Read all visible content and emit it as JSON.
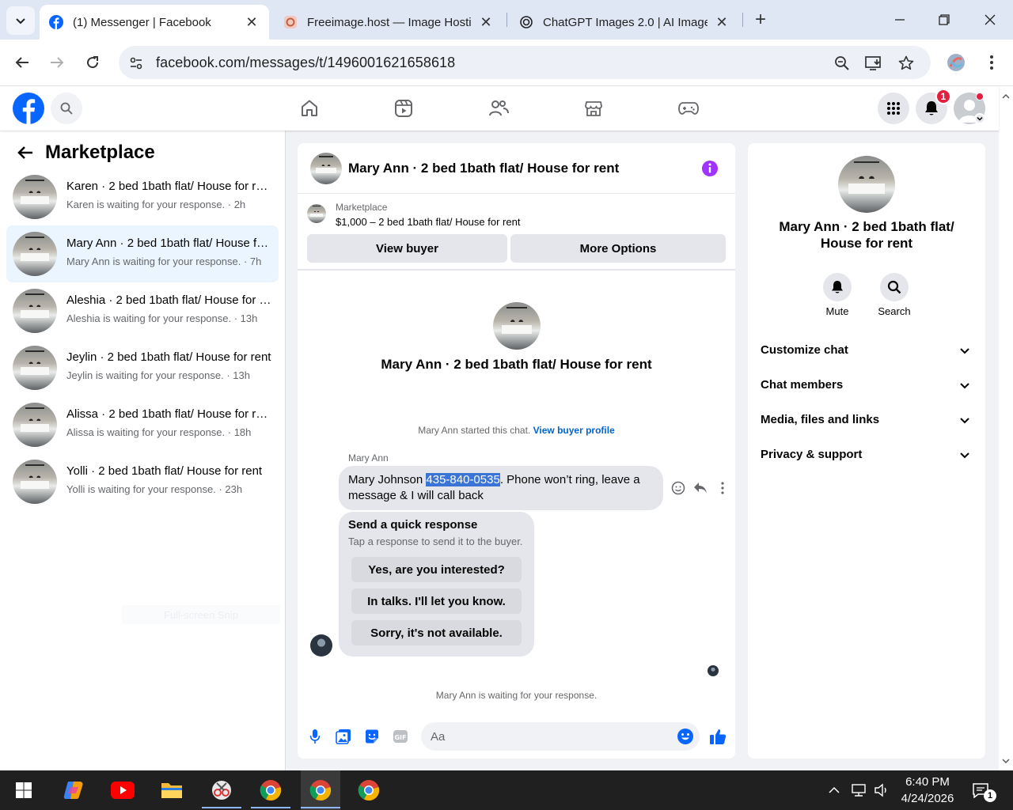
{
  "browser": {
    "tabs": [
      {
        "title": "(1) Messenger | Facebook",
        "active": true,
        "icon": "facebook-icon"
      },
      {
        "title": "Freeimage.host — Image Hosting",
        "active": false,
        "icon": "freeimage-icon"
      },
      {
        "title": "ChatGPT Images 2.0 | AI Image",
        "active": false,
        "icon": "openai-icon"
      }
    ],
    "url": "facebook.com/messages/t/1496001621658618"
  },
  "fb_header": {
    "notification_count": "1",
    "nav_icons": [
      "home-icon",
      "video-icon",
      "friends-icon",
      "marketplace-icon",
      "gaming-icon"
    ]
  },
  "sidebar": {
    "title": "Marketplace",
    "conversations": [
      {
        "name": "Karen · 2 bed 1bath flat/ House for rent",
        "status": "Karen is waiting for your response. · 2h",
        "selected": false
      },
      {
        "name": "Mary Ann · 2 bed 1bath flat/ House for rent",
        "status": "Mary Ann is waiting for your response. · 7h",
        "selected": true
      },
      {
        "name": "Aleshia · 2 bed 1bath flat/ House for rent",
        "status": "Aleshia is waiting for your response. · 13h",
        "selected": false
      },
      {
        "name": "Jeylin · 2 bed 1bath flat/ House for rent",
        "status": "Jeylin is waiting for your response. · 13h",
        "selected": false
      },
      {
        "name": "Alissa · 2 bed 1bath flat/ House for rent",
        "status": "Alissa is waiting for your response. · 18h",
        "selected": false
      },
      {
        "name": "Yolli · 2 bed 1bath flat/ House for rent",
        "status": "Yolli is waiting for your response. · 23h",
        "selected": false
      }
    ],
    "ghost_text": "Full-screen Snip"
  },
  "chat": {
    "title": "Mary Ann · 2 bed 1bath flat/ House for rent",
    "marketplace_label": "Marketplace",
    "listing": "$1,000 – 2 bed 1bath flat/ House for rent",
    "view_buyer": "View buyer",
    "more_options": "More Options",
    "intro_title": "Mary Ann · 2 bed 1bath flat/ House for rent",
    "started_text": "Mary Ann started this chat.",
    "view_buyer_profile": "View buyer profile",
    "sender": "Mary Ann",
    "message_before": "Mary Johnson ",
    "message_highlight": "435-840-0535",
    "message_after": ". Phone won’t ring, leave a message & I will call back",
    "quick_response_title": "Send a quick response",
    "quick_response_sub": "Tap a response to send it to the buyer.",
    "quick_responses": [
      "Yes, are you interested?",
      "In talks. I'll let you know.",
      "Sorry, it's not available."
    ],
    "waiting_text": "Mary Ann is waiting for your response.",
    "composer_placeholder": "Aa"
  },
  "info_panel": {
    "name": "Mary Ann · 2 bed 1bath flat/ House for rent",
    "mute": "Mute",
    "search": "Search",
    "sections": [
      "Customize chat",
      "Chat members",
      "Media, files and links",
      "Privacy & support"
    ]
  },
  "taskbar": {
    "time": "6:40 PM",
    "date": "4/24/2026",
    "notification_count": "1"
  },
  "colors": {
    "facebook_blue": "#0866ff",
    "messenger_purple": "#a033ff",
    "badge_red": "#e41e3f"
  }
}
